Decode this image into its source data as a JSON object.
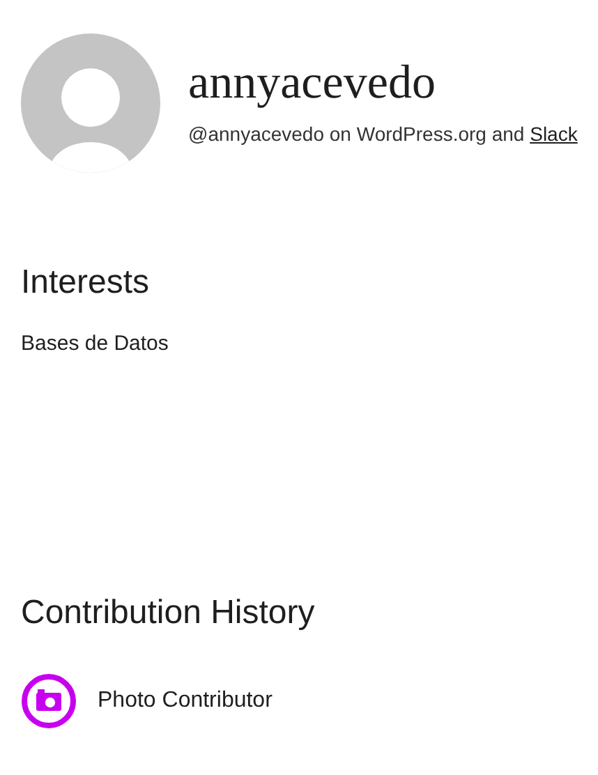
{
  "profile": {
    "username": "annyacevedo",
    "byline": {
      "text": "@annyacevedo on WordPress.org and",
      "link": "Slack"
    }
  },
  "interests": {
    "heading": "Interests",
    "items": [
      "Bases de Datos"
    ]
  },
  "contribution_history": {
    "heading": "Contribution History",
    "badges": [
      {
        "label": "Photo Contributor",
        "kind": "photo",
        "color": "#c800f0"
      }
    ]
  }
}
